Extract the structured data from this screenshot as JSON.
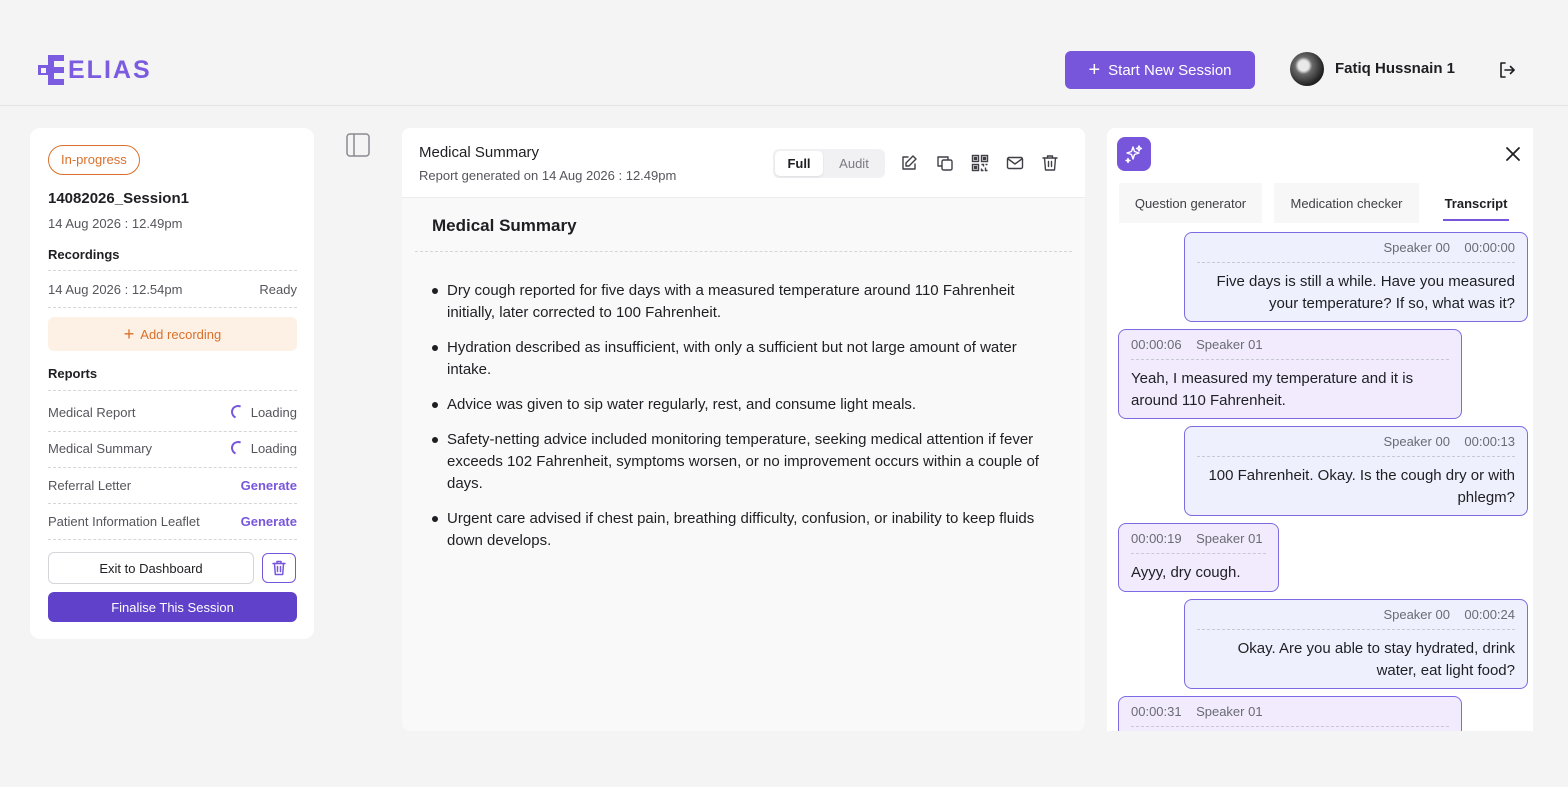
{
  "header": {
    "logo_text": "ELIAS",
    "start_button_label": "Start New Session",
    "user_name": "Fatiq Hussnain 1"
  },
  "session": {
    "status_badge": "In-progress",
    "title": "14082026_Session1",
    "date": "14 Aug 2026 : 12.49pm",
    "recordings_label": "Recordings",
    "recordings": [
      {
        "time": "14 Aug 2026 : 12.54pm",
        "status": "Ready"
      }
    ],
    "add_recording_label": "Add recording",
    "reports_label": "Reports",
    "reports": [
      {
        "name": "Medical Report",
        "status": "Loading"
      },
      {
        "name": "Medical Summary",
        "status": "Loading"
      },
      {
        "name": "Referral Letter",
        "status": "Generate"
      },
      {
        "name": "Patient Information Leaflet",
        "status": "Generate"
      }
    ],
    "exit_label": "Exit to Dashboard",
    "finalise_label": "Finalise This Session"
  },
  "report": {
    "title": "Medical Summary",
    "generated": "Report generated on 14 Aug 2026 : 12.49pm",
    "view_modes": [
      "Full",
      "Audit"
    ],
    "selected_mode": "Full",
    "heading": "Medical Summary",
    "bullets": [
      "Dry cough reported for five days with a measured temperature around 110 Fahrenheit initially, later corrected to 100 Fahrenheit.",
      "Hydration described as insufficient, with only a sufficient but not large amount of water intake.",
      "Advice was given to sip water regularly, rest, and consume light meals.",
      "Safety-netting advice included monitoring temperature, seeking medical attention if fever exceeds 102 Fahrenheit, symptoms worsen, or no improvement occurs within a couple of days.",
      "Urgent care advised if chest pain, breathing difficulty, confusion, or inability to keep fluids down develops."
    ]
  },
  "assistant": {
    "tabs": [
      "Question generator",
      "Medication checker",
      "Transcript"
    ],
    "active_tab": "Transcript",
    "transcript": [
      {
        "speaker": "Speaker 00",
        "time": "00:00:00",
        "text": "Five days is still a while. Have you measured your temperature? If so, what was it?"
      },
      {
        "speaker": "Speaker 01",
        "time": "00:00:06",
        "text": "Yeah, I measured my temperature and it is around 110 Fahrenheit."
      },
      {
        "speaker": "Speaker 00",
        "time": "00:00:13",
        "text": "100 Fahrenheit. Okay. Is the cough dry or with phlegm?"
      },
      {
        "speaker": "Speaker 01",
        "time": "00:00:19",
        "text": "Ayyy, dry cough."
      },
      {
        "speaker": "Speaker 00",
        "time": "00:00:24",
        "text": "Okay. Are you able to stay hydrated, drink water, eat light food?"
      },
      {
        "speaker": "Speaker 01",
        "time": "00:00:31",
        "text": ""
      }
    ]
  },
  "colors": {
    "brand": "#7856db",
    "accent_orange": "#d9702b",
    "finalise": "#6041c9"
  }
}
